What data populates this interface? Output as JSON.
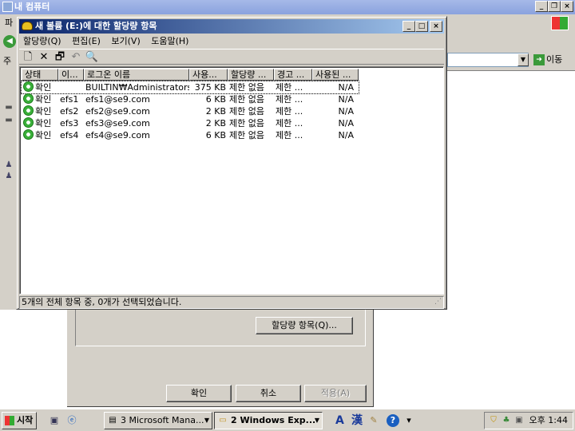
{
  "background_window": {
    "title": "내 컴퓨터",
    "menu_fragment": "파",
    "address_label": "주",
    "go_label": "이동",
    "controls": {
      "minimize": "_",
      "restore": "❐",
      "close": "×"
    }
  },
  "properties_dialog": {
    "quota_entries_button": "할당량 항목(Q)...",
    "ok_button": "확인",
    "cancel_button": "취소",
    "apply_button": "적용(A)"
  },
  "quota_window": {
    "title": "새 볼륨 (E:)에 대한 할당량 항목",
    "controls": {
      "minimize": "_",
      "maximize": "□",
      "close": "×"
    },
    "menu": [
      "할당량(Q)",
      "편집(E)",
      "보기(V)",
      "도움말(H)"
    ],
    "toolbar": {
      "new": "🗋",
      "delete": "✕",
      "properties": "🗗",
      "undo": "↶",
      "find": "🔍"
    },
    "columns": [
      "상태",
      "이...",
      "로그온 이름",
      "사용...",
      "할당량 ...",
      "경고 ...",
      "사용된 ..."
    ],
    "rows": [
      {
        "status": "확인",
        "name": "",
        "logon": "BUILTIN₩Administrators",
        "used": "375 KB",
        "quota": "제한 없음",
        "warning": "제한 ...",
        "percent": "N/A"
      },
      {
        "status": "확인",
        "name": "efs1",
        "logon": "efs1@se9.com",
        "used": "6 KB",
        "quota": "제한 없음",
        "warning": "제한 ...",
        "percent": "N/A"
      },
      {
        "status": "확인",
        "name": "efs2",
        "logon": "efs2@se9.com",
        "used": "2 KB",
        "quota": "제한 없음",
        "warning": "제한 ...",
        "percent": "N/A"
      },
      {
        "status": "확인",
        "name": "efs3",
        "logon": "efs3@se9.com",
        "used": "2 KB",
        "quota": "제한 없음",
        "warning": "제한 ...",
        "percent": "N/A"
      },
      {
        "status": "확인",
        "name": "efs4",
        "logon": "efs4@se9.com",
        "used": "6 KB",
        "quota": "제한 없음",
        "warning": "제한 ...",
        "percent": "N/A"
      }
    ],
    "status_bar": "5개의 전체 항목 중, 0개가 선택되었습니다."
  },
  "taskbar": {
    "start_label": "시작",
    "tasks": [
      {
        "label": "3 Microsoft Mana...",
        "active": false
      },
      {
        "label": "2 Windows Exp...",
        "active": true
      }
    ],
    "ime": {
      "mode": "A",
      "hanja": "漢"
    },
    "clock": "오후 1:44"
  }
}
